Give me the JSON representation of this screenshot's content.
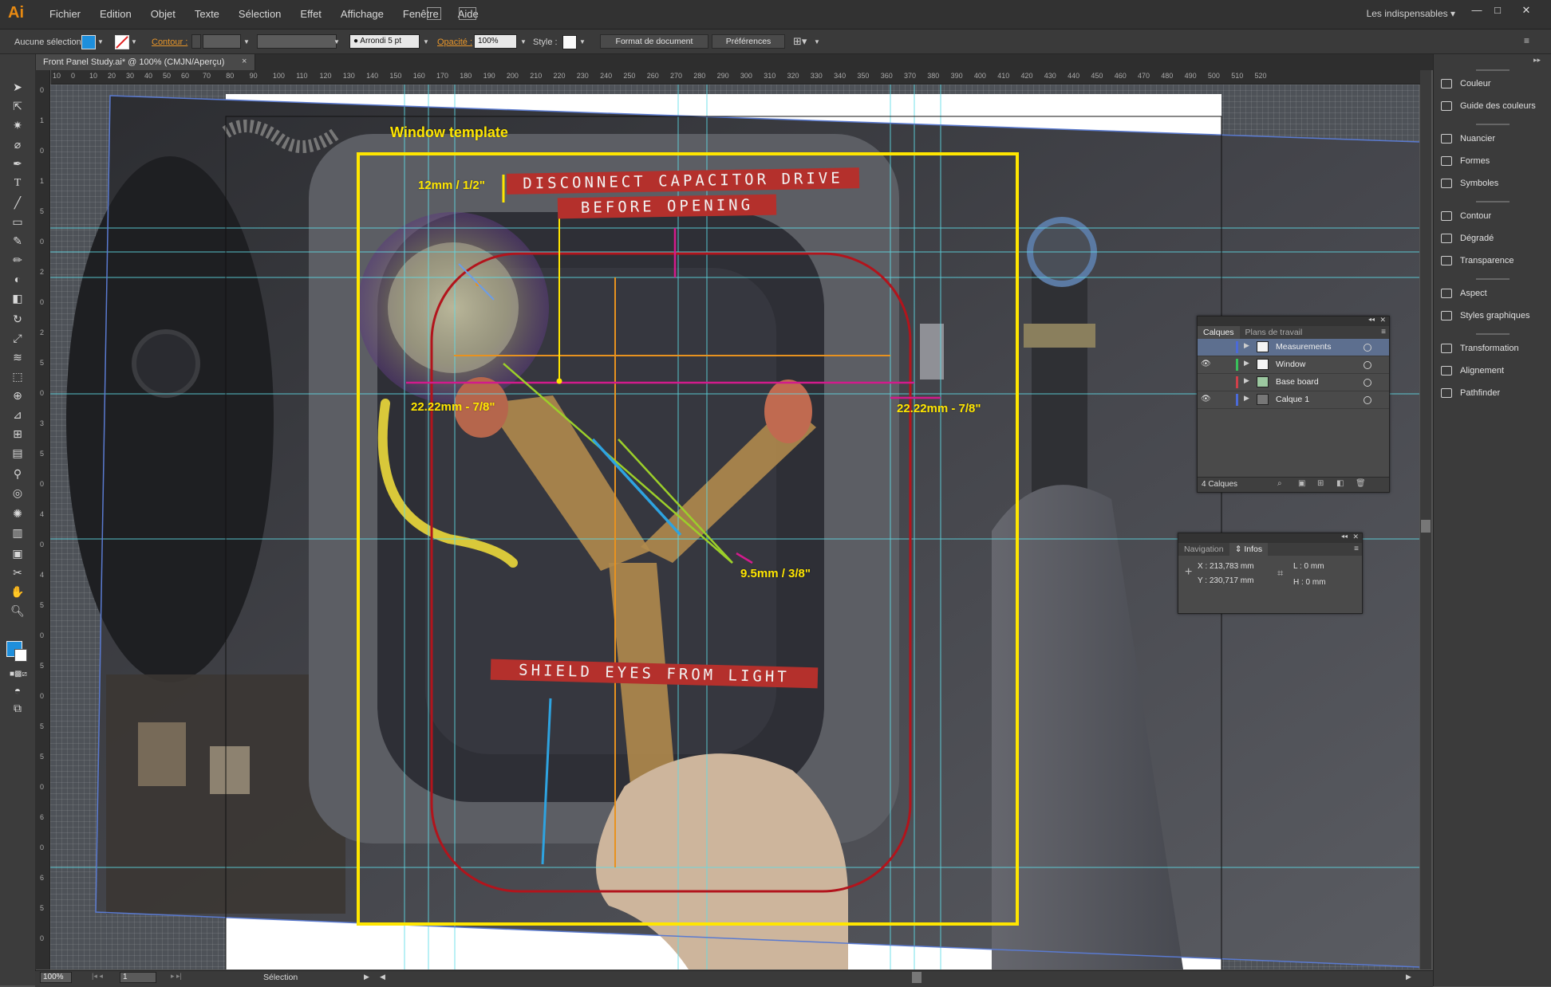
{
  "app": {
    "logo": "Ai",
    "workspace": "Les indispensables",
    "menu": [
      "Fichier",
      "Edition",
      "Objet",
      "Texte",
      "Sélection",
      "Effet",
      "Affichage",
      "Fenêtre",
      "Aide"
    ],
    "window_controls": [
      "—",
      "□",
      "✕"
    ]
  },
  "control_bar": {
    "selection": "Aucune sélection",
    "contour_label": "Contour :",
    "brush": "Arrondi 5 pt",
    "opacity_label": "Opacité :",
    "opacity_value": "100%",
    "style_label": "Style :",
    "doc_format_btn": "Format de document",
    "prefs_btn": "Préférences",
    "fill_color": "#1e8fdc"
  },
  "document": {
    "tab_title": "Front Panel Study.ai* @ 100% (CMJN/Aperçu)",
    "tab_close": "×"
  },
  "ruler": {
    "h_labels": [
      "70",
      "80",
      "90",
      "100",
      "110",
      "120",
      "130",
      "140",
      "150",
      "160",
      "170",
      "180",
      "190",
      "200",
      "210",
      "220",
      "230",
      "240",
      "250",
      "260",
      "270",
      "280",
      "290",
      "300",
      "310",
      "320",
      "330",
      "340",
      "350",
      "360",
      "370",
      "380",
      "390",
      "400",
      "410",
      "420",
      "430",
      "440",
      "450",
      "460",
      "470",
      "480",
      "490",
      "500",
      "510",
      "520"
    ],
    "h_prefix": [
      "10",
      "0",
      "10",
      "20",
      "30",
      "40",
      "50",
      "60"
    ],
    "v_labels": [
      "0",
      "1",
      "0",
      "1",
      "5",
      "0",
      "2",
      "0",
      "2",
      "5",
      "0",
      "3",
      "5",
      "0",
      "4",
      "0",
      "4",
      "5",
      "0",
      "5",
      "0",
      "5",
      "5",
      "0",
      "6",
      "0",
      "6",
      "5",
      "0"
    ]
  },
  "artwork": {
    "window_template_label": "Window template",
    "measure_top": "12mm / 1/2\"",
    "measure_left": "22.22mm - 7/8\"",
    "measure_right": "22.22mm - 7/8\"",
    "measure_center": "9.5mm / 3/8\"",
    "sign_top_line1": "DISCONNECT CAPACITOR DRIVE",
    "sign_top_line2": "BEFORE OPENING",
    "sign_bottom": "SHIELD EYES FROM LIGHT",
    "template_color": "#ffe600",
    "guide_color": "#5fdde8",
    "outline_color": "#b2141c"
  },
  "layers_panel": {
    "tabs": [
      "Calques",
      "Plans de travail"
    ],
    "layers": [
      {
        "name": "Measurements",
        "color": "#4b6ad8",
        "visible": false,
        "selected": true
      },
      {
        "name": "Window",
        "color": "#39c05b",
        "visible": true,
        "selected": false
      },
      {
        "name": "Base board",
        "color": "#d0404a",
        "visible": false,
        "selected": false
      },
      {
        "name": "Calque 1",
        "color": "#4b6ad8",
        "visible": true,
        "selected": false
      }
    ],
    "count": "4 Calques"
  },
  "info_panel": {
    "tabs": [
      "Navigation",
      "Infos"
    ],
    "x": "X : 213,783 mm",
    "y": "Y : 230,717 mm",
    "w": "L : 0 mm",
    "h": "H : 0 mm"
  },
  "dock": {
    "groups": [
      [
        "Couleur",
        "Guide des couleurs"
      ],
      [
        "Nuancier",
        "Formes",
        "Symboles"
      ],
      [
        "Contour",
        "Dégradé",
        "Transparence"
      ],
      [
        "Aspect",
        "Styles graphiques"
      ],
      [
        "Transformation",
        "Alignement",
        "Pathfinder"
      ]
    ]
  },
  "status_bar": {
    "zoom": "100%",
    "artboard": "1",
    "tool": "Sélection"
  }
}
